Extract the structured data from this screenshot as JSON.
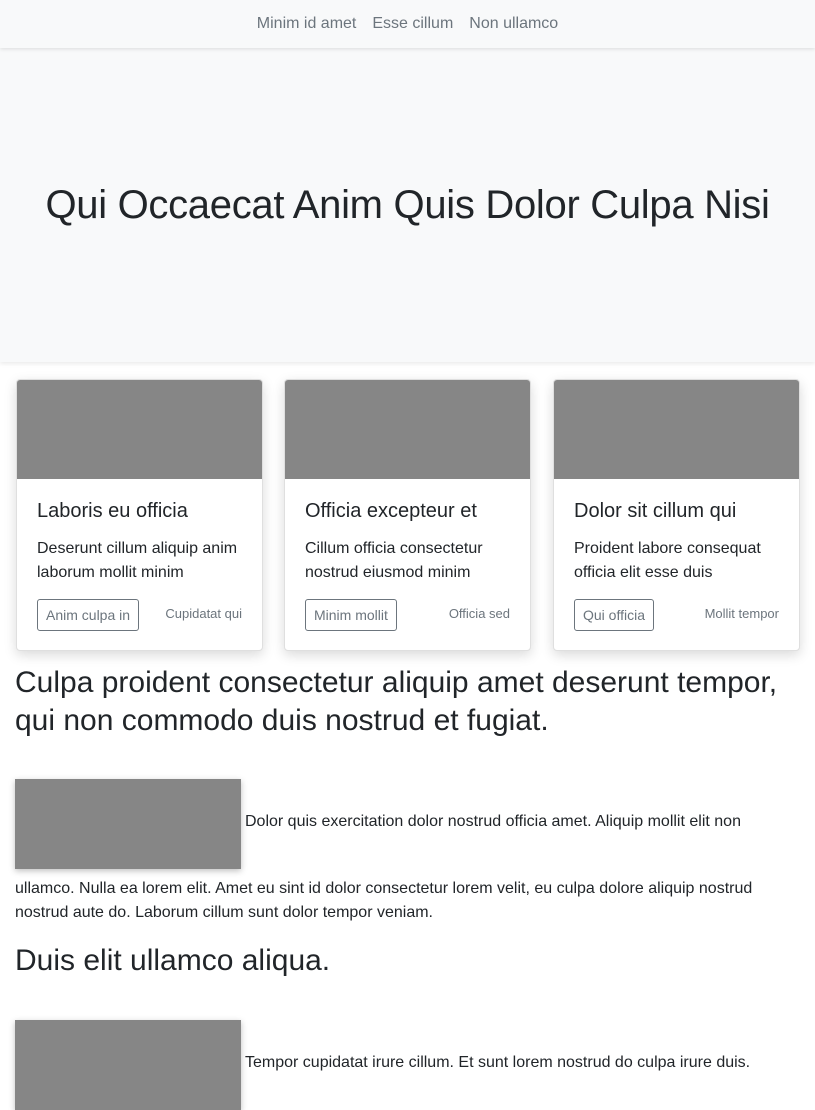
{
  "nav": {
    "links": [
      "Minim id amet",
      "Esse cillum",
      "Non ullamco"
    ]
  },
  "hero": {
    "title": "Qui Occaecat Anim Quis Dolor Culpa Nisi"
  },
  "cards": [
    {
      "title": "Laboris eu officia",
      "text": "Deserunt cillum aliquip anim laborum mollit minim",
      "button": "Anim culpa in",
      "meta": "Cupidatat qui"
    },
    {
      "title": "Officia excepteur et",
      "text": "Cillum officia consectetur nostrud eiusmod minim",
      "button": "Minim mollit",
      "meta": "Officia sed"
    },
    {
      "title": "Dolor sit cillum qui",
      "text": "Proident labore consequat officia elit esse duis",
      "button": "Qui officia",
      "meta": "Mollit tempor"
    }
  ],
  "article": {
    "heading1": "Culpa proident consectetur aliquip amet deserunt tempor, qui non commodo duis nostrud et fugiat.",
    "para1_inline": "Dolor quis exercitation dolor nostrud officia amet. Aliquip mollit elit non",
    "para1_rest": "ullamco. Nulla ea lorem elit. Amet eu sint id dolor consectetur lorem velit, eu culpa dolore aliquip nostrud nostrud aute do. Laborum cillum sunt dolor tempor veniam.",
    "heading2": "Duis elit ullamco aliqua.",
    "para2_inline": "Tempor cupidatat irure cillum. Et sunt lorem nostrud do culpa irure duis."
  },
  "colors": {
    "navbar_bg": "#f8f9fa",
    "placeholder_gray": "#868686",
    "muted_text": "#6c757d",
    "body_text": "#212529"
  }
}
